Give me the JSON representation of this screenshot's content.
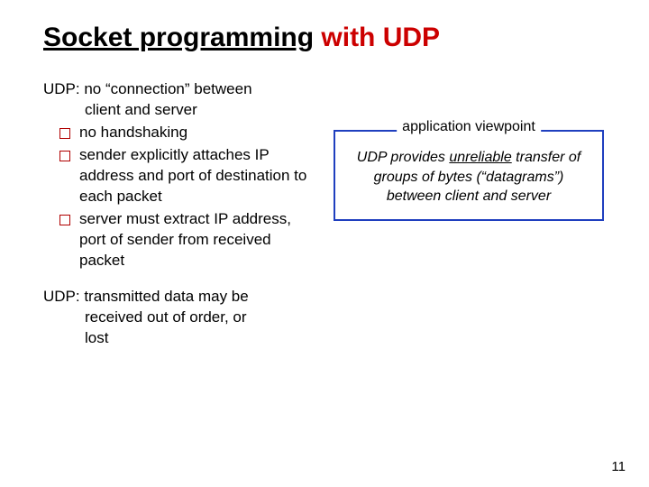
{
  "title": {
    "part1": "Socket programming",
    "part2": " with UDP"
  },
  "left": {
    "heading1_a": "UDP: no “connection” between",
    "heading1_b": "client and server",
    "bullets": [
      "no handshaking",
      "sender explicitly attaches IP address and port of destination to each packet",
      "server must extract IP address, port of sender from received packet"
    ],
    "heading2_a": "UDP: transmitted data may be",
    "heading2_b": "received out of order, or",
    "heading2_c": "lost"
  },
  "right": {
    "legend": "application viewpoint",
    "box_pre": "UDP provides ",
    "box_unreliable": "unreliable",
    "box_mid": " transfer of groups of bytes (“datagrams”) between client and server"
  },
  "page": "11"
}
